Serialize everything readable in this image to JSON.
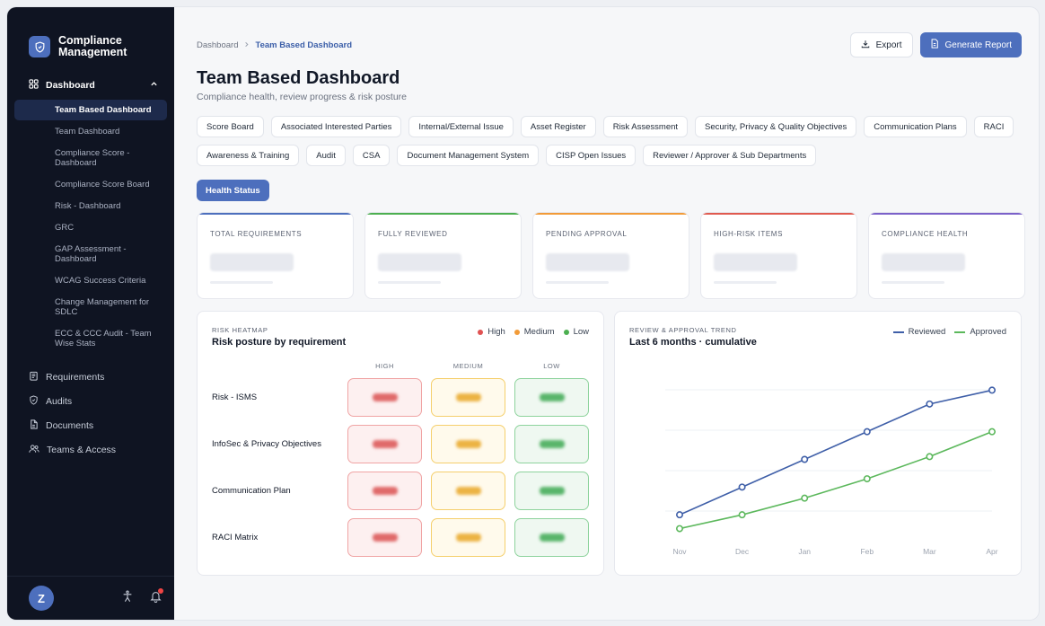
{
  "app": {
    "name_line1": "Compliance",
    "name_line2": "Management"
  },
  "sidebar": {
    "group": "Dashboard",
    "subitems": [
      "Team Based Dashboard",
      "Team Dashboard",
      "Compliance Score - Dashboard",
      "Compliance Score Board",
      "Risk - Dashboard",
      "GRC",
      "GAP Assessment - Dashboard",
      "WCAG Success Criteria",
      "Change Management for SDLC",
      "ECC & CCC Audit - Team Wise Stats"
    ],
    "active_index": 0,
    "items": [
      "Requirements",
      "Audits",
      "Documents",
      "Teams & Access"
    ],
    "avatar_initial": "Z"
  },
  "breadcrumb": {
    "root": "Dashboard",
    "current": "Team Based Dashboard"
  },
  "actions": {
    "export": "Export",
    "generate": "Generate Report"
  },
  "page": {
    "title": "Team Based Dashboard",
    "subtitle": "Compliance health, review progress & risk posture"
  },
  "tabs": [
    "Score Board",
    "Associated Interested Parties",
    "Internal/External Issue",
    "Asset Register",
    "Risk Assessment",
    "Security, Privacy & Quality Objectives",
    "Communication Plans",
    "RACI",
    "Awareness & Training",
    "Audit",
    "CSA",
    "Document Management System",
    "CISP Open Issues",
    "Reviewer / Approver & Sub Departments"
  ],
  "active_tab": "Health Status",
  "stats": [
    {
      "label": "TOTAL REQUIREMENTS",
      "color": "#4d6fbd"
    },
    {
      "label": "FULLY REVIEWED",
      "color": "#4caf50"
    },
    {
      "label": "PENDING APPROVAL",
      "color": "#f29b38"
    },
    {
      "label": "HIGH-RISK ITEMS",
      "color": "#e05a4f"
    },
    {
      "label": "COMPLIANCE HEALTH",
      "color": "#7b61c9"
    }
  ],
  "heatmap": {
    "kicker": "RISK HEATMAP",
    "title": "Risk posture by requirement",
    "legend": [
      {
        "label": "High",
        "color": "#e05252"
      },
      {
        "label": "Medium",
        "color": "#f29b38"
      },
      {
        "label": "Low",
        "color": "#4caf50"
      }
    ],
    "columns": [
      "HIGH",
      "MEDIUM",
      "LOW"
    ],
    "rows": [
      "Risk - ISMS",
      "InfoSec & Privacy Objectives",
      "Communication Plan",
      "RACI Matrix"
    ]
  },
  "trend": {
    "kicker": "REVIEW & APPROVAL TREND",
    "title": "Last 6 months · cumulative",
    "legend": [
      {
        "label": "Reviewed",
        "color": "#3f5fa8"
      },
      {
        "label": "Approved",
        "color": "#5cb85c"
      }
    ]
  },
  "chart_data": {
    "type": "line",
    "categories": [
      "Nov",
      "Dec",
      "Jan",
      "Feb",
      "Mar",
      "Apr"
    ],
    "series": [
      {
        "name": "Reviewed",
        "color": "#3f5fa8",
        "values": [
          0,
          1,
          2,
          3,
          4,
          4.5
        ]
      },
      {
        "name": "Approved",
        "color": "#5cb85c",
        "values": [
          -0.5,
          0,
          0.6,
          1.3,
          2.1,
          3
        ]
      }
    ],
    "ylim": [
      -1,
      5
    ],
    "grid": true,
    "legend": "top-right",
    "title": "",
    "xlabel": "",
    "ylabel": ""
  }
}
